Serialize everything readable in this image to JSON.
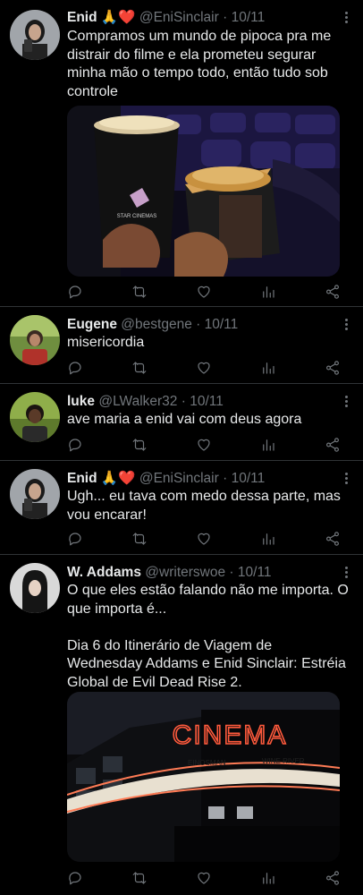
{
  "tweets": [
    {
      "name": "Enid",
      "emoji": "🙏❤️",
      "handle": "@EniSinclair",
      "sep": "·",
      "date": "10/11",
      "text": "Compramos um mundo de pipoca pra me distrair do filme e ela prometeu segurar minha mão o tempo todo, então tudo sob controle"
    },
    {
      "name": "Eugene",
      "handle": "@bestgene",
      "sep": "·",
      "date": "10/11",
      "text": "misericordia"
    },
    {
      "name": "luke",
      "handle": "@LWalker32",
      "sep": "·",
      "date": "10/11",
      "text": "ave maria a enid vai com deus agora"
    },
    {
      "name": "Enid",
      "emoji": "🙏❤️",
      "handle": "@EniSinclair",
      "sep": "·",
      "date": "10/11",
      "text": "Ugh... eu tava com medo dessa parte, mas vou encarar!"
    },
    {
      "name": "W. Addams",
      "handle": "@writerswoe",
      "sep": "·",
      "date": "10/11",
      "text": "O que eles estão falando não me importa. O que importa é...\n\nDia 6 do Itinerário de Viagem de Wednesday Addams e Enid Sinclair: Estréia Global de Evil Dead Rise 2."
    }
  ],
  "media": {
    "cup_brand": "STAR CINEMAS",
    "sign": "CINEMA",
    "marquee_left": "EINOSMAN",
    "marquee_right": "WINE RIVER"
  },
  "icons": [
    "reply-icon",
    "retweet-icon",
    "like-icon",
    "views-icon",
    "share-icon"
  ],
  "colors": {
    "background": "#000000",
    "text": "#e7e9ea",
    "secondary": "#71767b",
    "divider": "#2f3336",
    "neon": "#ff5a3c"
  }
}
